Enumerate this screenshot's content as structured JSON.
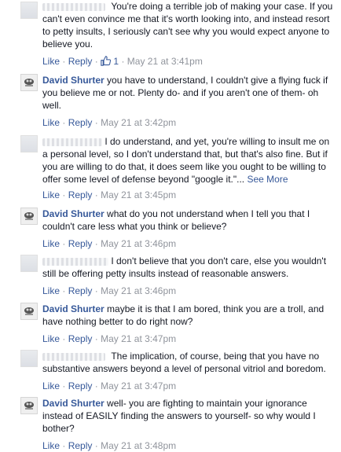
{
  "link_color": "#365899",
  "meta_color": "#90949c",
  "icons": {
    "avatar": "user-avatar",
    "like": "thumbs-up-icon"
  },
  "comments": [
    {
      "author": "",
      "text": "You're doing a terrible job of making your case. If you can't even convince me that it's worth looking into, and instead resort to petty insults, I seriously can't see why you would expect anyone to believe you.",
      "like": "Like",
      "reply": "Reply",
      "like_count": "1",
      "time": "May 21 at 3:41pm"
    },
    {
      "author": "David Shurter",
      "text": "you have to understand, I couldn't give a flying fuck if you believe me or not. Plenty do- and if you aren't one of them- oh well.",
      "like": "Like",
      "reply": "Reply",
      "time": "May 21 at 3:42pm"
    },
    {
      "author": "",
      "text": "I do understand, and yet, you're willing to insult me on a personal level, so I don't understand that, but that's also fine. But if you are willing to do that, it does seem like you ought to be willing to offer some level of defense beyond \"google it.\"...",
      "see_more": "See More",
      "like": "Like",
      "reply": "Reply",
      "time": "May 21 at 3:45pm"
    },
    {
      "author": "David Shurter",
      "text": "what do you not understand when I tell you that I couldn't care less what you think or believe?",
      "like": "Like",
      "reply": "Reply",
      "time": "May 21 at 3:46pm"
    },
    {
      "author": "",
      "text": "I don't believe that you don't care, else you wouldn't still be offering petty insults instead of reasonable answers.",
      "like": "Like",
      "reply": "Reply",
      "time": "May 21 at 3:46pm"
    },
    {
      "author": "David Shurter",
      "text": "maybe it is that I am bored, think you are a troll, and have nothing better to do right now?",
      "like": "Like",
      "reply": "Reply",
      "time": "May 21 at 3:47pm"
    },
    {
      "author": "",
      "text": "The implication, of course, being that you have no substantive answers beyond a level of personal vitriol and boredom.",
      "like": "Like",
      "reply": "Reply",
      "time": "May 21 at 3:47pm"
    },
    {
      "author": "David Shurter",
      "text": "well- you are fighting to maintain your ignorance instead of EASILY finding the answers to yourself- so why would I bother?",
      "like": "Like",
      "reply": "Reply",
      "time": "May 21 at 3:48pm"
    }
  ]
}
